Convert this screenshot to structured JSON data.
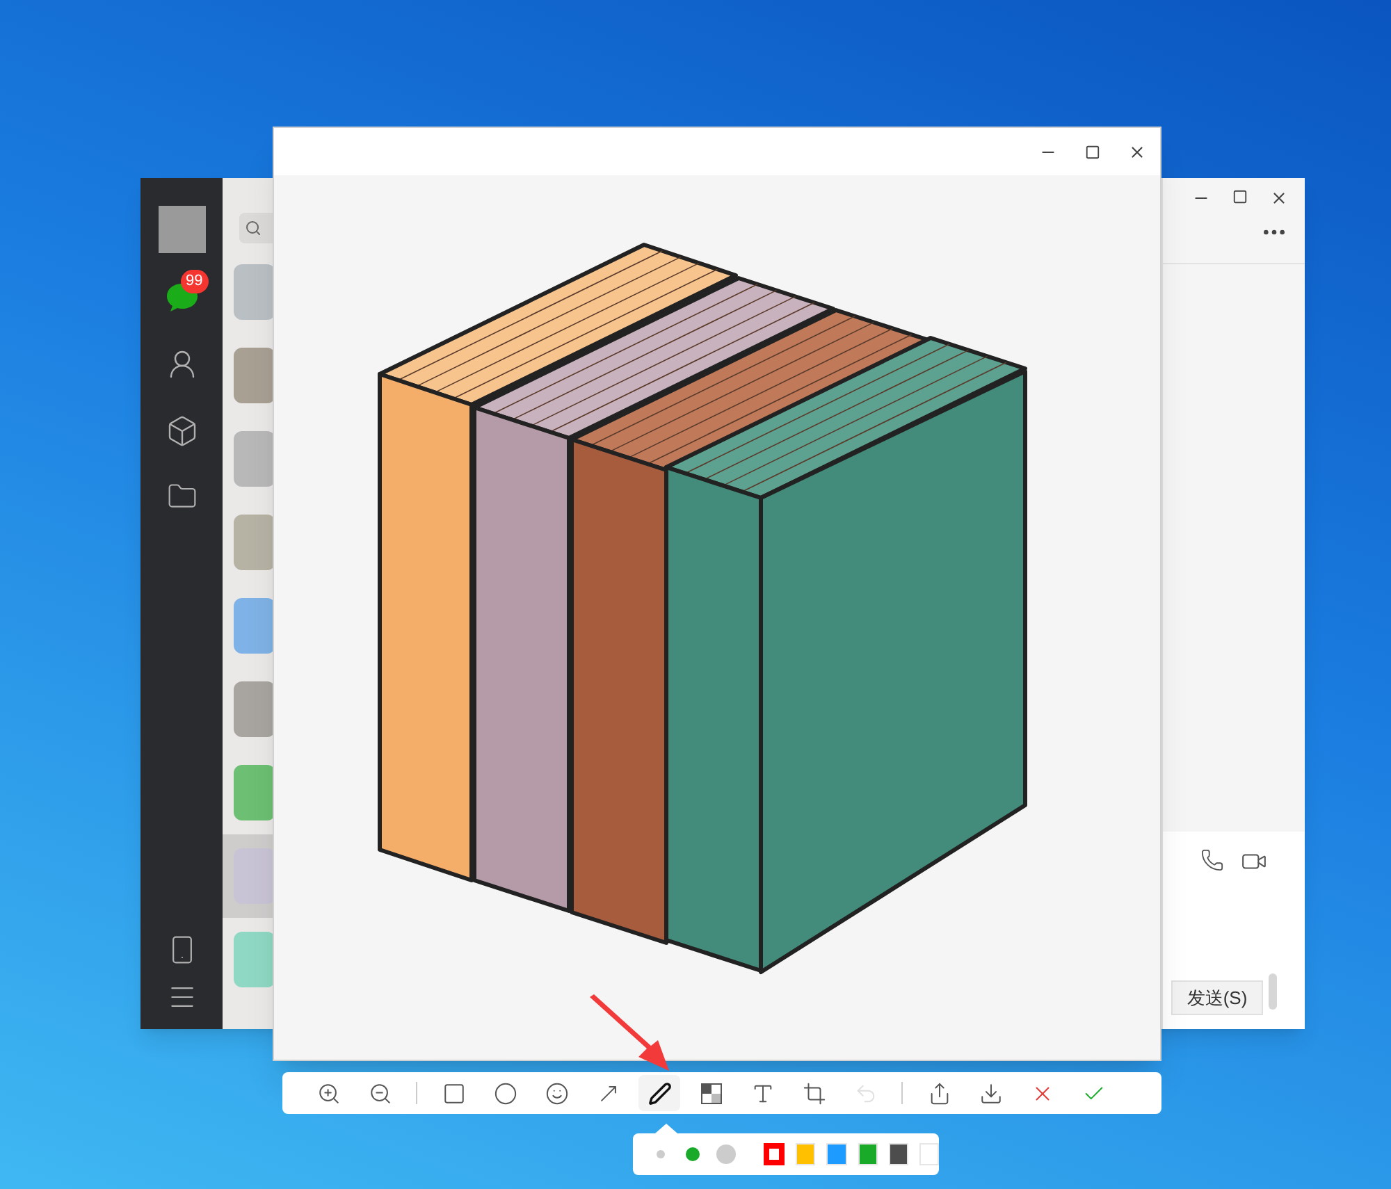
{
  "chat_window": {
    "unread_badge": "99",
    "send_button": "发送(S)",
    "conversations": [
      {
        "selected": false
      },
      {
        "selected": false
      },
      {
        "selected": false
      },
      {
        "selected": false
      },
      {
        "selected": false
      },
      {
        "selected": false
      },
      {
        "selected": false
      },
      {
        "selected": true
      },
      {
        "selected": false
      }
    ]
  },
  "viewer": {
    "tools": [
      {
        "kind": "zoom-in",
        "selected": false,
        "disabled": false
      },
      {
        "kind": "zoom-out",
        "selected": false,
        "disabled": false
      },
      {
        "kind": "separator"
      },
      {
        "kind": "rectangle",
        "selected": false,
        "disabled": false
      },
      {
        "kind": "ellipse",
        "selected": false,
        "disabled": false
      },
      {
        "kind": "emoji",
        "selected": false,
        "disabled": false
      },
      {
        "kind": "arrow",
        "selected": false,
        "disabled": false
      },
      {
        "kind": "pen",
        "selected": true,
        "disabled": false
      },
      {
        "kind": "mosaic",
        "selected": false,
        "disabled": false
      },
      {
        "kind": "text",
        "selected": false,
        "disabled": false
      },
      {
        "kind": "crop",
        "selected": false,
        "disabled": false
      },
      {
        "kind": "undo",
        "selected": false,
        "disabled": true
      },
      {
        "kind": "separator"
      },
      {
        "kind": "share",
        "selected": false,
        "disabled": false
      },
      {
        "kind": "download",
        "selected": false,
        "disabled": false
      },
      {
        "kind": "cancel",
        "selected": false,
        "disabled": false
      },
      {
        "kind": "confirm",
        "selected": false,
        "disabled": false
      }
    ]
  },
  "pen_options": {
    "sizes": [
      {
        "selected": false
      },
      {
        "selected": true
      },
      {
        "selected": false
      }
    ],
    "colors": [
      {
        "color": "#ff0000",
        "selected": true
      },
      {
        "color": "#ffc000",
        "selected": false
      },
      {
        "color": "#1e9bff",
        "selected": false
      },
      {
        "color": "#1aaa2a",
        "selected": false
      },
      {
        "color": "#4d4d4d",
        "selected": false
      },
      {
        "color": "#ffffff",
        "selected": false
      }
    ]
  }
}
